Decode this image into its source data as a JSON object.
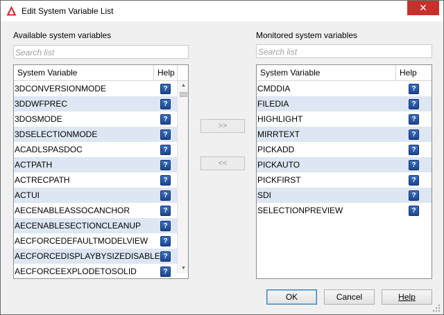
{
  "window": {
    "title": "Edit System Variable List",
    "close_glyph": "✕",
    "app_icon": "autocad-logo-icon",
    "close_color": "#c7312b"
  },
  "available": {
    "label": "Available system variables",
    "search_placeholder": "Search list",
    "columns": {
      "name": "System Variable",
      "help": "Help"
    },
    "rows": [
      "3DCONVERSIONMODE",
      "3DDWFPREC",
      "3DOSMODE",
      "3DSELECTIONMODE",
      "ACADLSPASDOC",
      "ACTPATH",
      "ACTRECPATH",
      "ACTUI",
      "AECENABLEASSOCANCHOR",
      "AECENABLESECTIONCLEANUP",
      "AECFORCEDEFAULTMODELVIEW",
      "AECFORCEDISPLAYBYSIZEDISABLED",
      "AECFORCEEXPLODETOSOLID"
    ]
  },
  "monitored": {
    "label": "Monitored system variables",
    "search_placeholder": "Search list",
    "columns": {
      "name": "System Variable",
      "help": "Help"
    },
    "rows": [
      "CMDDIA",
      "FILEDIA",
      "HIGHLIGHT",
      "MIRRTEXT",
      "PICKADD",
      "PICKAUTO",
      "PICKFIRST",
      "SDI",
      "SELECTIONPREVIEW"
    ]
  },
  "move": {
    "add_label": ">>",
    "remove_label": "<<"
  },
  "buttons": {
    "ok": "OK",
    "cancel": "Cancel",
    "help": "Help"
  },
  "icons": {
    "help": "help-icon",
    "scroll_up": "scroll-up-arrow-icon",
    "scroll_down": "scroll-down-arrow-icon",
    "grip": "resize-grip-icon"
  },
  "colors": {
    "alt_row": "#dde7f3",
    "help_icon": "#2a5aa8"
  }
}
